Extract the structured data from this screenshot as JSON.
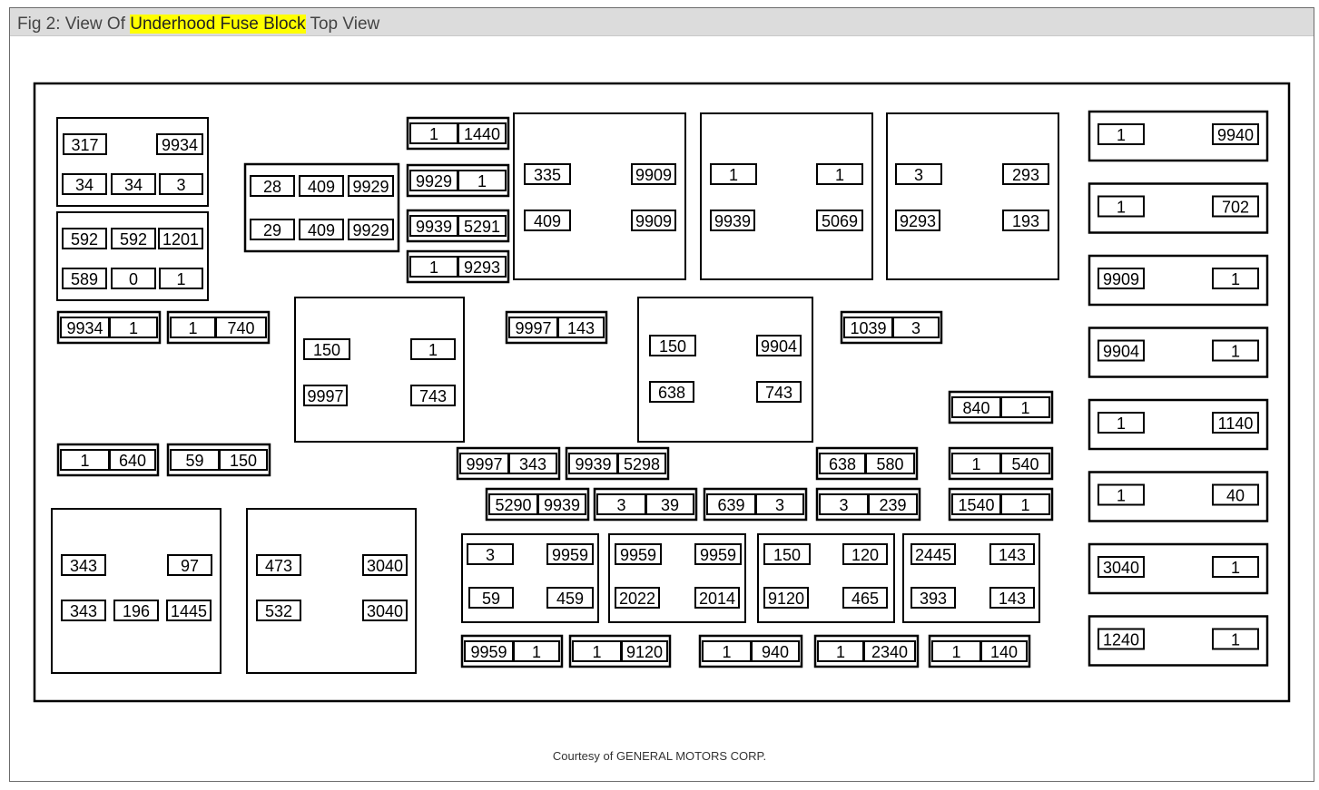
{
  "title": {
    "prefix": "Fig 2: View Of ",
    "highlight": "Underhood Fuse Block",
    "suffix": " Top View",
    "highlight_color": "#ffff00"
  },
  "caption": "Courtesy of GENERAL MOTORS CORP.",
  "colors": {
    "line": "#000000",
    "background": "#ffffff",
    "titlebar": "#dcdcdc"
  },
  "labels": {
    "a1": "317",
    "a2": "9934",
    "a3": "34",
    "a4": "34",
    "a5": "3",
    "b1": "592",
    "b2": "592",
    "b3": "1201",
    "b4": "589",
    "b5": "0",
    "b6": "1",
    "c1": "9934",
    "c2": "1",
    "c3": "1",
    "c4": "740",
    "d1": "28",
    "d2": "409",
    "d3": "9929",
    "d4": "29",
    "d5": "409",
    "d6": "9929",
    "e1": "1",
    "e2": "1440",
    "e3": "9929",
    "e4": "1",
    "e5": "9939",
    "e6": "5291",
    "e7": "1",
    "e8": "9293",
    "f1": "335",
    "f2": "9909",
    "f3": "409",
    "f4": "9909",
    "g1": "1",
    "g2": "1",
    "g3": "9939",
    "g4": "5069",
    "h1": "3",
    "h2": "293",
    "h3": "9293",
    "h4": "193",
    "r1a": "1",
    "r1b": "9940",
    "r2a": "1",
    "r2b": "702",
    "r3a": "9909",
    "r3b": "1",
    "r4a": "9904",
    "r4b": "1",
    "r5a": "1",
    "r5b": "1140",
    "r6a": "1",
    "r6b": "40",
    "r7a": "3040",
    "r7b": "1",
    "r8a": "1240",
    "r8b": "1",
    "i1": "150",
    "i2": "1",
    "i3": "9997",
    "i4": "743",
    "j1": "9997",
    "j2": "143",
    "k1": "150",
    "k2": "9904",
    "k3": "638",
    "k4": "743",
    "l1": "1039",
    "l2": "3",
    "m1": "840",
    "m2": "1",
    "n1": "1",
    "n2": "640",
    "n3": "59",
    "n4": "150",
    "o1": "9997",
    "o2": "343",
    "o3": "9939",
    "o4": "5298",
    "p1": "638",
    "p2": "580",
    "p3": "1",
    "p4": "540",
    "q1": "5290",
    "q2": "9939",
    "q3": "3",
    "q4": "39",
    "q5": "639",
    "q6": "3",
    "q7": "3",
    "q8": "239",
    "s1": "1540",
    "s2": "1",
    "t1": "343",
    "t2": "97",
    "t3": "343",
    "t4": "196",
    "t5": "1445",
    "u1": "473",
    "u2": "3040",
    "u3": "532",
    "u4": "3040",
    "v1": "3",
    "v2": "9959",
    "v3": "59",
    "v4": "459",
    "w1": "9959",
    "w2": "9959",
    "w3": "2022",
    "w4": "2014",
    "x1": "150",
    "x2": "120",
    "x3": "9120",
    "x4": "465",
    "y1": "2445",
    "y2": "143",
    "y3": "393",
    "y4": "143",
    "z1": "9959",
    "z2": "1",
    "z3": "1",
    "z4": "9120",
    "z5": "1",
    "z6": "940",
    "z7": "1",
    "z8": "2340",
    "z9": "1",
    "z10": "140"
  }
}
